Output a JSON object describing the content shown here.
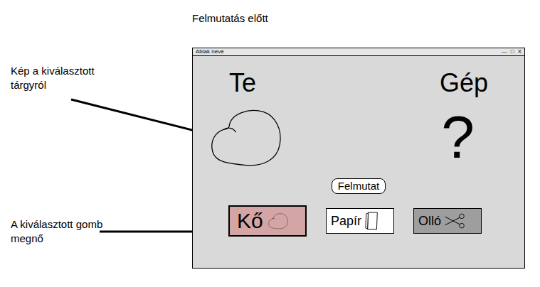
{
  "heading": "Felmutatás előtt",
  "annotations": [
    {
      "text": "Kép a kiválasztott tárgyról"
    },
    {
      "text": "A kiválasztott gomb megnő"
    }
  ],
  "window": {
    "title": "Ablak neve",
    "controls": [
      "—",
      "□",
      "X"
    ]
  },
  "players": {
    "you": "Te",
    "computer": "Gép"
  },
  "computer_choice": "?",
  "show_button": "Felmutat",
  "choices": [
    {
      "label": "Kő",
      "kind": "rock",
      "selected": true,
      "color": "#d4a5a5"
    },
    {
      "label": "Papír",
      "kind": "paper",
      "selected": false,
      "color": "#ffffff"
    },
    {
      "label": "Olló",
      "kind": "scissors",
      "selected": false,
      "color": "#9e9e9e"
    }
  ]
}
